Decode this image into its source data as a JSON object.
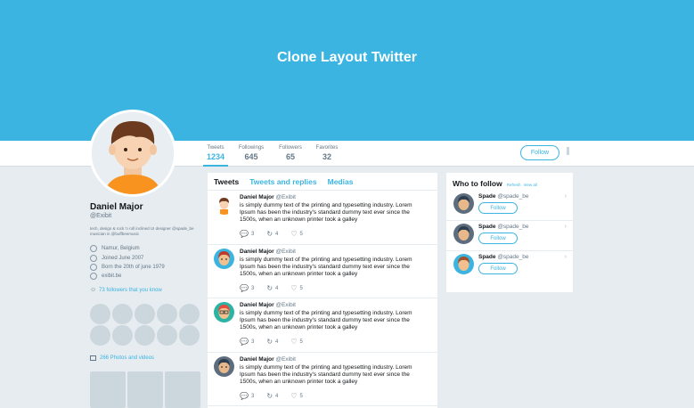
{
  "banner": {
    "title": "Clone Layout Twitter"
  },
  "stats": [
    {
      "label": "Tweets",
      "value": "1234"
    },
    {
      "label": "Followings",
      "value": "645"
    },
    {
      "label": "Followers",
      "value": "65"
    },
    {
      "label": "Favorites",
      "value": "32"
    }
  ],
  "header": {
    "follow_label": "Follow"
  },
  "profile": {
    "name": "Daniel Major",
    "handle": "@Exibit",
    "bio": "tech, design & rock 'n roll inclined UI designer @spade_be musician in @buffbeemusic",
    "location": "Namur, Belgium",
    "joined": "Joined June 2007",
    "born": "Born the 20th of june 1979",
    "website": "exibit.be",
    "followers_known": "73 followers that you know",
    "photos_videos": "266 Photos and videos"
  },
  "feed": {
    "tabs": [
      "Tweets",
      "Tweets and replies",
      "Medias"
    ],
    "tweets": [
      {
        "name": "Daniel Major",
        "handle": "@Exibit",
        "text": "is simply dummy text of the printing and typesetting industry. Lorem Ipsum has been the industry's standard dummy text ever since the 1500s, when an unknown printer took a galley",
        "replies": "3",
        "retweets": "4",
        "likes": "5"
      },
      {
        "name": "Daniel Major",
        "handle": "@Exibit",
        "text": "is simply dummy text of the printing and typesetting industry. Lorem Ipsum has been the industry's standard dummy text ever since the 1500s, when an unknown printer took a galley",
        "replies": "3",
        "retweets": "4",
        "likes": "5"
      },
      {
        "name": "Daniel Major",
        "handle": "@Exibit",
        "text": "is simply dummy text of the printing and typesetting industry. Lorem Ipsum has been the industry's standard dummy text ever since the 1500s, when an unknown printer took a galley",
        "replies": "3",
        "retweets": "4",
        "likes": "5"
      },
      {
        "name": "Daniel Major",
        "handle": "@Exibit",
        "text": "is simply dummy text of the printing and typesetting industry. Lorem Ipsum has been the industry's standard dummy text ever since the 1500s, when an unknown printer took a galley",
        "replies": "3",
        "retweets": "4",
        "likes": "5"
      }
    ]
  },
  "who_to_follow": {
    "title": "Who to follow",
    "refresh": "Refresh",
    "view_all": "View all",
    "suggestions": [
      {
        "name": "Spade",
        "handle": "@spade_be",
        "button": "Follow"
      },
      {
        "name": "Spade",
        "handle": "@spade_be",
        "button": "Follow"
      },
      {
        "name": "Spade",
        "handle": "@spade_be",
        "button": "Follow"
      }
    ]
  },
  "icons": {
    "location": "map-pin-icon",
    "joined": "calendar-icon",
    "born": "birthday-icon",
    "website": "link-icon",
    "followers": "user-icon",
    "photos": "image-icon",
    "reply": "reply-icon",
    "retweet": "retweet-icon",
    "like": "heart-icon",
    "dismiss": "close-icon"
  },
  "colors": {
    "accent": "#3bb4e1",
    "background": "#e6ecf0",
    "muted": "#657786"
  }
}
